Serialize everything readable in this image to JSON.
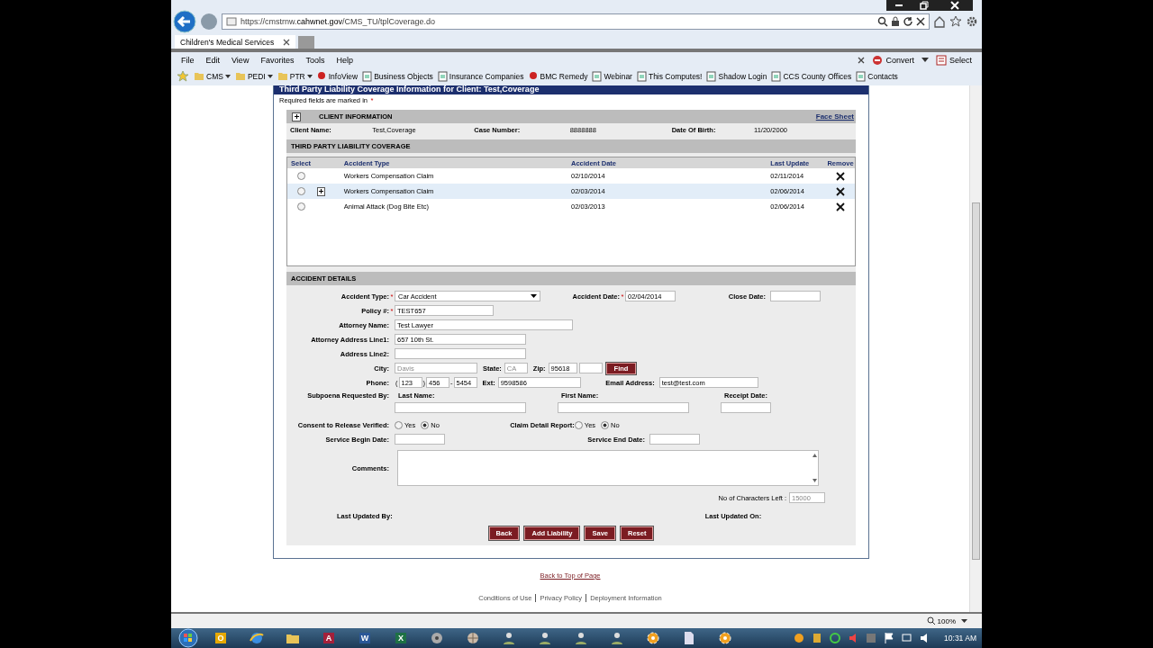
{
  "browser": {
    "url_prefix": "https://cmstrnw.",
    "url_domain": "cahwnet.gov",
    "url_path": "/CMS_TU/tplCoverage.do",
    "tab": "Children's Medical Services",
    "menu": [
      "File",
      "Edit",
      "View",
      "Favorites",
      "Tools",
      "Help"
    ],
    "favorites": [
      {
        "kind": "folder",
        "label": "CMS"
      },
      {
        "kind": "folder",
        "label": "PEDI"
      },
      {
        "kind": "folder",
        "label": "PTR"
      },
      {
        "kind": "app",
        "label": "InfoView"
      },
      {
        "kind": "page",
        "label": "Business Objects"
      },
      {
        "kind": "page",
        "label": "Insurance Companies"
      },
      {
        "kind": "app",
        "label": "BMC Remedy"
      },
      {
        "kind": "page",
        "label": "Webinar"
      },
      {
        "kind": "page",
        "label": "This Computes!"
      },
      {
        "kind": "page",
        "label": "Shadow Login"
      },
      {
        "kind": "page",
        "label": "CCS County Offices"
      },
      {
        "kind": "page",
        "label": "Contacts"
      }
    ],
    "convert": "Convert",
    "select": "Select",
    "zoom": "100%"
  },
  "page": {
    "title": "Third Party Liability Coverage Information for Client: Test,Coverage",
    "required_note": "Required fields are marked in",
    "required_mark": "*",
    "client_info": {
      "title": "CLIENT INFORMATION",
      "link": "Face Sheet",
      "fields": [
        {
          "label": "Client Name:",
          "value": "Test,Coverage"
        },
        {
          "label": "Case Number:",
          "value": "8888888"
        },
        {
          "label": "Date Of Birth:",
          "value": "11/20/2000"
        }
      ]
    },
    "coverage": {
      "title": "THIRD PARTY LIABILITY COVERAGE",
      "columns": [
        "Select",
        "Accident Type",
        "Accident Date",
        "Last Update",
        "Remove"
      ],
      "rows": [
        {
          "selected": false,
          "expandable": false,
          "highlighted": false,
          "type": "Workers Compensation Claim",
          "date": "02/10/2014",
          "last_update": "02/11/2014"
        },
        {
          "selected": false,
          "expandable": true,
          "highlighted": true,
          "type": "Workers Compensation Claim",
          "date": "02/03/2014",
          "last_update": "02/06/2014"
        },
        {
          "selected": false,
          "expandable": false,
          "highlighted": false,
          "type": "Animal Attack (Dog Bite Etc)",
          "date": "02/03/2013",
          "last_update": "02/06/2014"
        }
      ]
    },
    "details": {
      "title": "ACCIDENT DETAILS",
      "accident_type": {
        "label": "Accident Type:",
        "value": "Car Accident",
        "required": true
      },
      "accident_date": {
        "label": "Accident Date:",
        "value": "02/04/2014",
        "required": true
      },
      "close_date": {
        "label": "Close Date:"
      },
      "policy": {
        "label": "Policy #:",
        "value": "TEST657",
        "required": true
      },
      "attorney_name": {
        "label": "Attorney Name:",
        "value": "Test Lawyer"
      },
      "address1": {
        "label": "Attorney Address Line1:",
        "value": "657 10th St."
      },
      "address2": {
        "label": "Address Line2:"
      },
      "city": {
        "label": "City:",
        "value": "Davis",
        "disabled": true
      },
      "state": {
        "label": "State:",
        "value": "CA",
        "disabled": true
      },
      "zip": {
        "label": "Zip:",
        "value": "95618"
      },
      "find": "Find",
      "phone": {
        "label": "Phone:",
        "open": "(",
        "area": "123",
        "close": ")",
        "prefix": "456",
        "dash": "-",
        "line": "5454"
      },
      "ext": {
        "label": "Ext:",
        "value": "9598586"
      },
      "email": {
        "label": "Email Address:",
        "value": "test@test.com"
      },
      "subpoena": "Subpoena Requested By:",
      "last_name": "Last Name:",
      "first_name": "First Name:",
      "receipt_date": "Receipt Date:",
      "consent": {
        "label": "Consent to Release Verified:",
        "options": [
          {
            "label": "Yes",
            "selected": false
          },
          {
            "label": "No",
            "selected": true
          }
        ]
      },
      "claim_report": {
        "label": "Claim Detail Report:",
        "options": [
          {
            "label": "Yes",
            "selected": false
          },
          {
            "label": "No",
            "selected": true
          }
        ]
      },
      "service_begin": "Service Begin Date:",
      "service_end": "Service End Date:",
      "comments": "Comments:",
      "chars_left": {
        "label": "No of Characters Left :",
        "value": "15000"
      },
      "last_updated_by": "Last Updated By:",
      "last_updated_on": "Last Updated On:",
      "buttons": [
        "Back",
        "Add Liability",
        "Save",
        "Reset"
      ]
    },
    "back_to_top": "Back to Top of Page",
    "footer_links": [
      "Conditions of Use",
      "Privacy Policy",
      "Deployment Information"
    ]
  },
  "taskbar": {
    "apps": [
      {
        "kind": "letter",
        "label": "O",
        "color": "#e6a800"
      },
      {
        "kind": "ie"
      },
      {
        "kind": "folder"
      },
      {
        "kind": "letter",
        "label": "A",
        "color": "#a4203a"
      },
      {
        "kind": "letter",
        "label": "W",
        "color": "#2b5797"
      },
      {
        "kind": "letter",
        "label": "X",
        "color": "#1e7145"
      },
      {
        "kind": "disc"
      },
      {
        "kind": "globe"
      },
      {
        "kind": "person"
      },
      {
        "kind": "person"
      },
      {
        "kind": "person"
      },
      {
        "kind": "person"
      },
      {
        "kind": "flower"
      },
      {
        "kind": "doc"
      },
      {
        "kind": "flower"
      }
    ],
    "clock": "10:31 AM"
  }
}
